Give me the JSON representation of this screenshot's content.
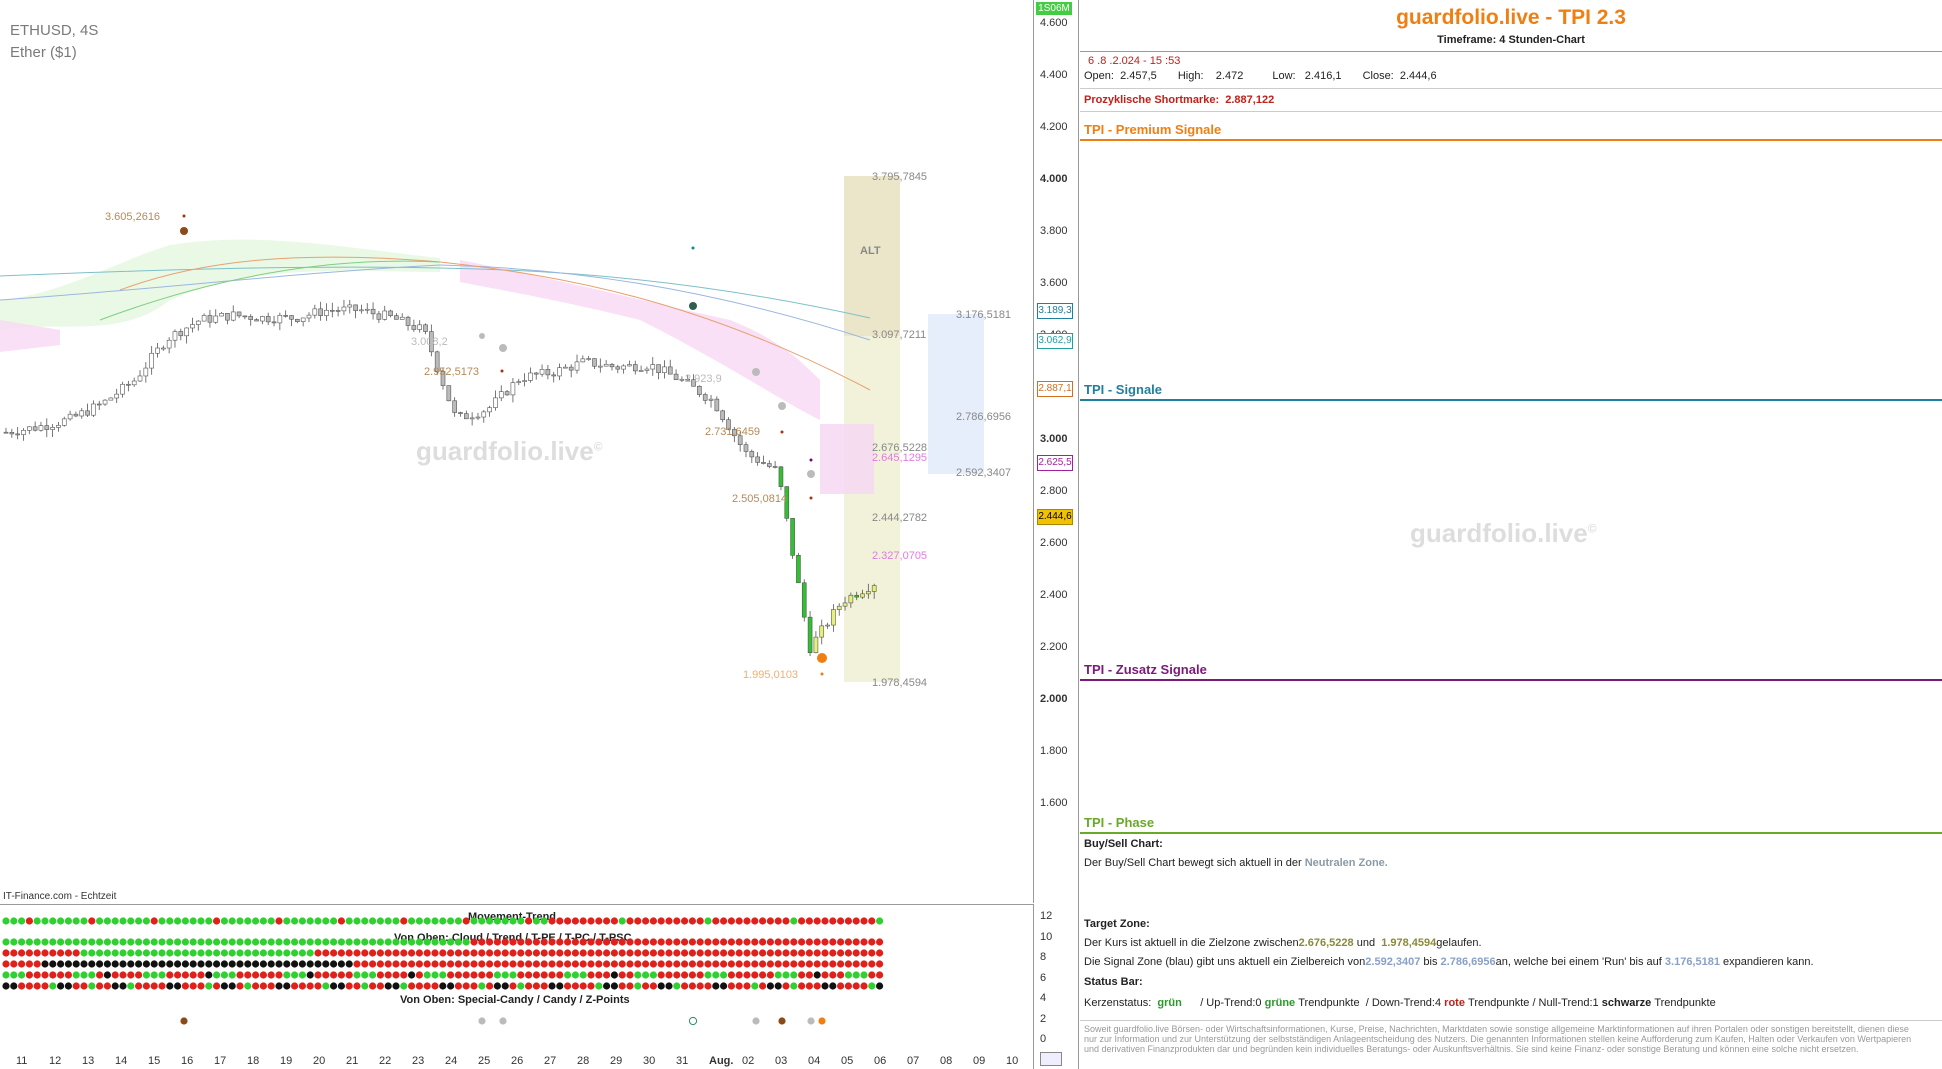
{
  "chart": {
    "symbol": "ETHUSD, 4S",
    "name": "Ether ($1)",
    "source": "IT-Finance.com - Echtzeit",
    "watermark": "guardfolio.live",
    "reg": "©",
    "alt_label": "ALT",
    "volume_badge": "1S06M",
    "levels": {
      "l3605": "3.605,2616",
      "l3795": "3.795,7845",
      "l3097": "3.097,7211",
      "l3176": "3.176,5181",
      "l3008": "3.008,2",
      "l2952": "2.952,5173",
      "l2923": "2.923,9",
      "l2786": "2.786,6956",
      "l2731": "2.731,6459",
      "l2676": "2.676,5228",
      "l2645": "2.645,1295",
      "l2592": "2.592,3407",
      "l2505": "2.505,0814",
      "l2444": "2.444,2782",
      "l2327": "2.327,0705",
      "l1995": "1.995,0103",
      "l1978": "1.978,4594"
    },
    "price_boxes": {
      "b3189": "3.189,3",
      "b3062": "3.062,9",
      "b2887": "2.887,1",
      "b2625": "2.625,5",
      "b2444": "2.444,6"
    }
  },
  "y_axis": [
    "4.600",
    "4.400",
    "4.200",
    "4.000",
    "3.800",
    "3.600",
    "3.400",
    "3.200",
    "3.000",
    "2.800",
    "2.600",
    "2.400",
    "2.200",
    "2.000",
    "1.800",
    "1.600"
  ],
  "x_axis": [
    "11",
    "12",
    "13",
    "14",
    "15",
    "16",
    "17",
    "18",
    "19",
    "20",
    "21",
    "22",
    "23",
    "24",
    "25",
    "26",
    "27",
    "28",
    "29",
    "30",
    "31",
    "Aug.",
    "02",
    "03",
    "04",
    "05",
    "06",
    "07",
    "08",
    "09",
    "10",
    "11"
  ],
  "indicator": {
    "title_movement": "Movement-Trend",
    "title_cloud": "Von Oben: Cloud / Trend / T-PE / T-PC / T-PSC",
    "title_candy": "Von Oben: Special-Candy / Candy / Z-Points",
    "ticks": [
      "12",
      "10",
      "8",
      "6",
      "4",
      "2",
      "0"
    ]
  },
  "info": {
    "title": "guardfolio.live - TPI 2.3",
    "timeframe": "Timeframe: 4 Stunden-Chart",
    "datetime": "6 .8 .2.024  - 15 :53",
    "open_label": "Open:",
    "open": "2.457,5",
    "high_label": "High:",
    "high": "2.472",
    "low_label": "Low:",
    "low": "2.416,1",
    "close_label": "Close:",
    "close": "2.444,6",
    "short_label": "Prozyklische Shortmarke:",
    "short_value": "2.887,122",
    "sec_premium": "TPI - Premium Signale",
    "sec_signale": "TPI - Signale",
    "sec_zusatz": "TPI - Zusatz Signale",
    "sec_phase": "TPI - Phase",
    "watermark": "guardfolio.live",
    "reg": "©",
    "buysell_title": "Buy/Sell Chart:",
    "buysell_text": "Der Buy/Sell Chart bewegt sich aktuell in der",
    "buysell_zone": "Neutralen Zone.",
    "target_title": "Target Zone:",
    "target_t1": "Der Kurs ist aktuell in die Zielzone zwischen",
    "target_v1": "2.676,5228",
    "target_t2": "und",
    "target_v2": "1.978,4594",
    "target_t3": "gelaufen.",
    "signal_t1": "Die Signal Zone (blau) gibt uns aktuell ein Zielbereich von",
    "signal_v1": "2.592,3407",
    "signal_t2": "bis",
    "signal_v2": "2.786,6956",
    "signal_t3": "an, welche bei einem 'Run' bis auf",
    "signal_v3": "3.176,5181",
    "signal_t4": "expandieren kann.",
    "status_title": "Status Bar:",
    "status_k": "Kerzenstatus:",
    "status_gruen": "grün",
    "status_up": "/ Up-Trend:0",
    "status_gruene": "grüne",
    "status_tp1": "Trendpunkte",
    "status_down": "/ Down-Trend:4",
    "status_rote": "rote",
    "status_tp2": "Trendpunkte",
    "status_null": "/ Null-Trend:1",
    "status_schwarze": "schwarze",
    "status_tp3": "Trendpunkte",
    "disclaimer": "Soweit guardfolio.live Börsen- oder Wirtschaftsinformationen, Kurse, Preise, Nachrichten, Marktdaten sowie sonstige allgemeine Marktinformationen auf ihren Portalen oder sonstigen bereitstellt, dienen diese nur zur Information und zur Unterstützung der selbstständigen Anlageentscheidung des Nutzers. Die genannten Informationen stellen keine Aufforderung zum Kaufen, Halten oder Verkaufen von Wertpapieren und derivativen Finanzprodukten dar und begründen kein individuelles Beratungs- oder Auskunftsverhältnis. Sie sind keine Finanz- oder sonstige Beratung und können eine solche nicht ersetzen."
  },
  "colors": {
    "orange": "#f07f12",
    "teal": "#1f7f9f",
    "purple": "#7a1a7a",
    "green_line": "#6aa82a",
    "red_text": "#c0201a",
    "level_brown": "#b58a57",
    "level_grey": "#888888",
    "level_pink": "#e07be0"
  },
  "chart_data": {
    "type": "candlestick",
    "title": "ETHUSD, 4S",
    "subtitle": "Ether ($1)",
    "ylim": [
      1550,
      4650
    ],
    "x": [
      "11",
      "12",
      "13",
      "14",
      "15",
      "16",
      "17",
      "18",
      "19",
      "20",
      "21",
      "22",
      "23",
      "24",
      "25",
      "26",
      "27",
      "28",
      "29",
      "30",
      "31",
      "Aug.",
      "02",
      "03",
      "04",
      "05",
      "06",
      "07",
      "08",
      "09",
      "10",
      "11"
    ],
    "close_path": [
      3030,
      3050,
      3080,
      3140,
      3230,
      3390,
      3460,
      3480,
      3470,
      3470,
      3500,
      3500,
      3470,
      3420,
      3080,
      3120,
      3240,
      3260,
      3300,
      3280,
      3290,
      3230,
      3150,
      2950,
      2880,
      2200,
      2380,
      2450
    ],
    "last": {
      "open": 2457.5,
      "high": 2472,
      "low": 2416.1,
      "close": 2444.6
    },
    "levels": [
      3605.2616,
      3795.7845,
      3097.7211,
      3176.5181,
      3008.2,
      2952.5173,
      2923.9,
      2786.6956,
      2731.6459,
      2676.5228,
      2645.1295,
      2592.3407,
      2505.0814,
      2444.2782,
      2327.0705,
      1995.0103,
      1978.4594
    ],
    "indicator_rows": 6
  }
}
